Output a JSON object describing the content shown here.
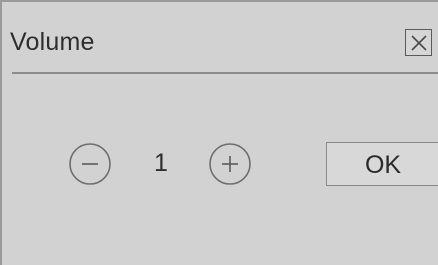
{
  "dialog": {
    "title": "Volume",
    "close_icon": "close-icon"
  },
  "volume": {
    "value": "1",
    "decrease_icon": "minus-circle-icon",
    "increase_icon": "plus-circle-icon"
  },
  "actions": {
    "ok_label": "OK"
  },
  "colors": {
    "background": "#d2d2d2",
    "text": "#2e2e2e",
    "border": "#8a8a8a"
  }
}
